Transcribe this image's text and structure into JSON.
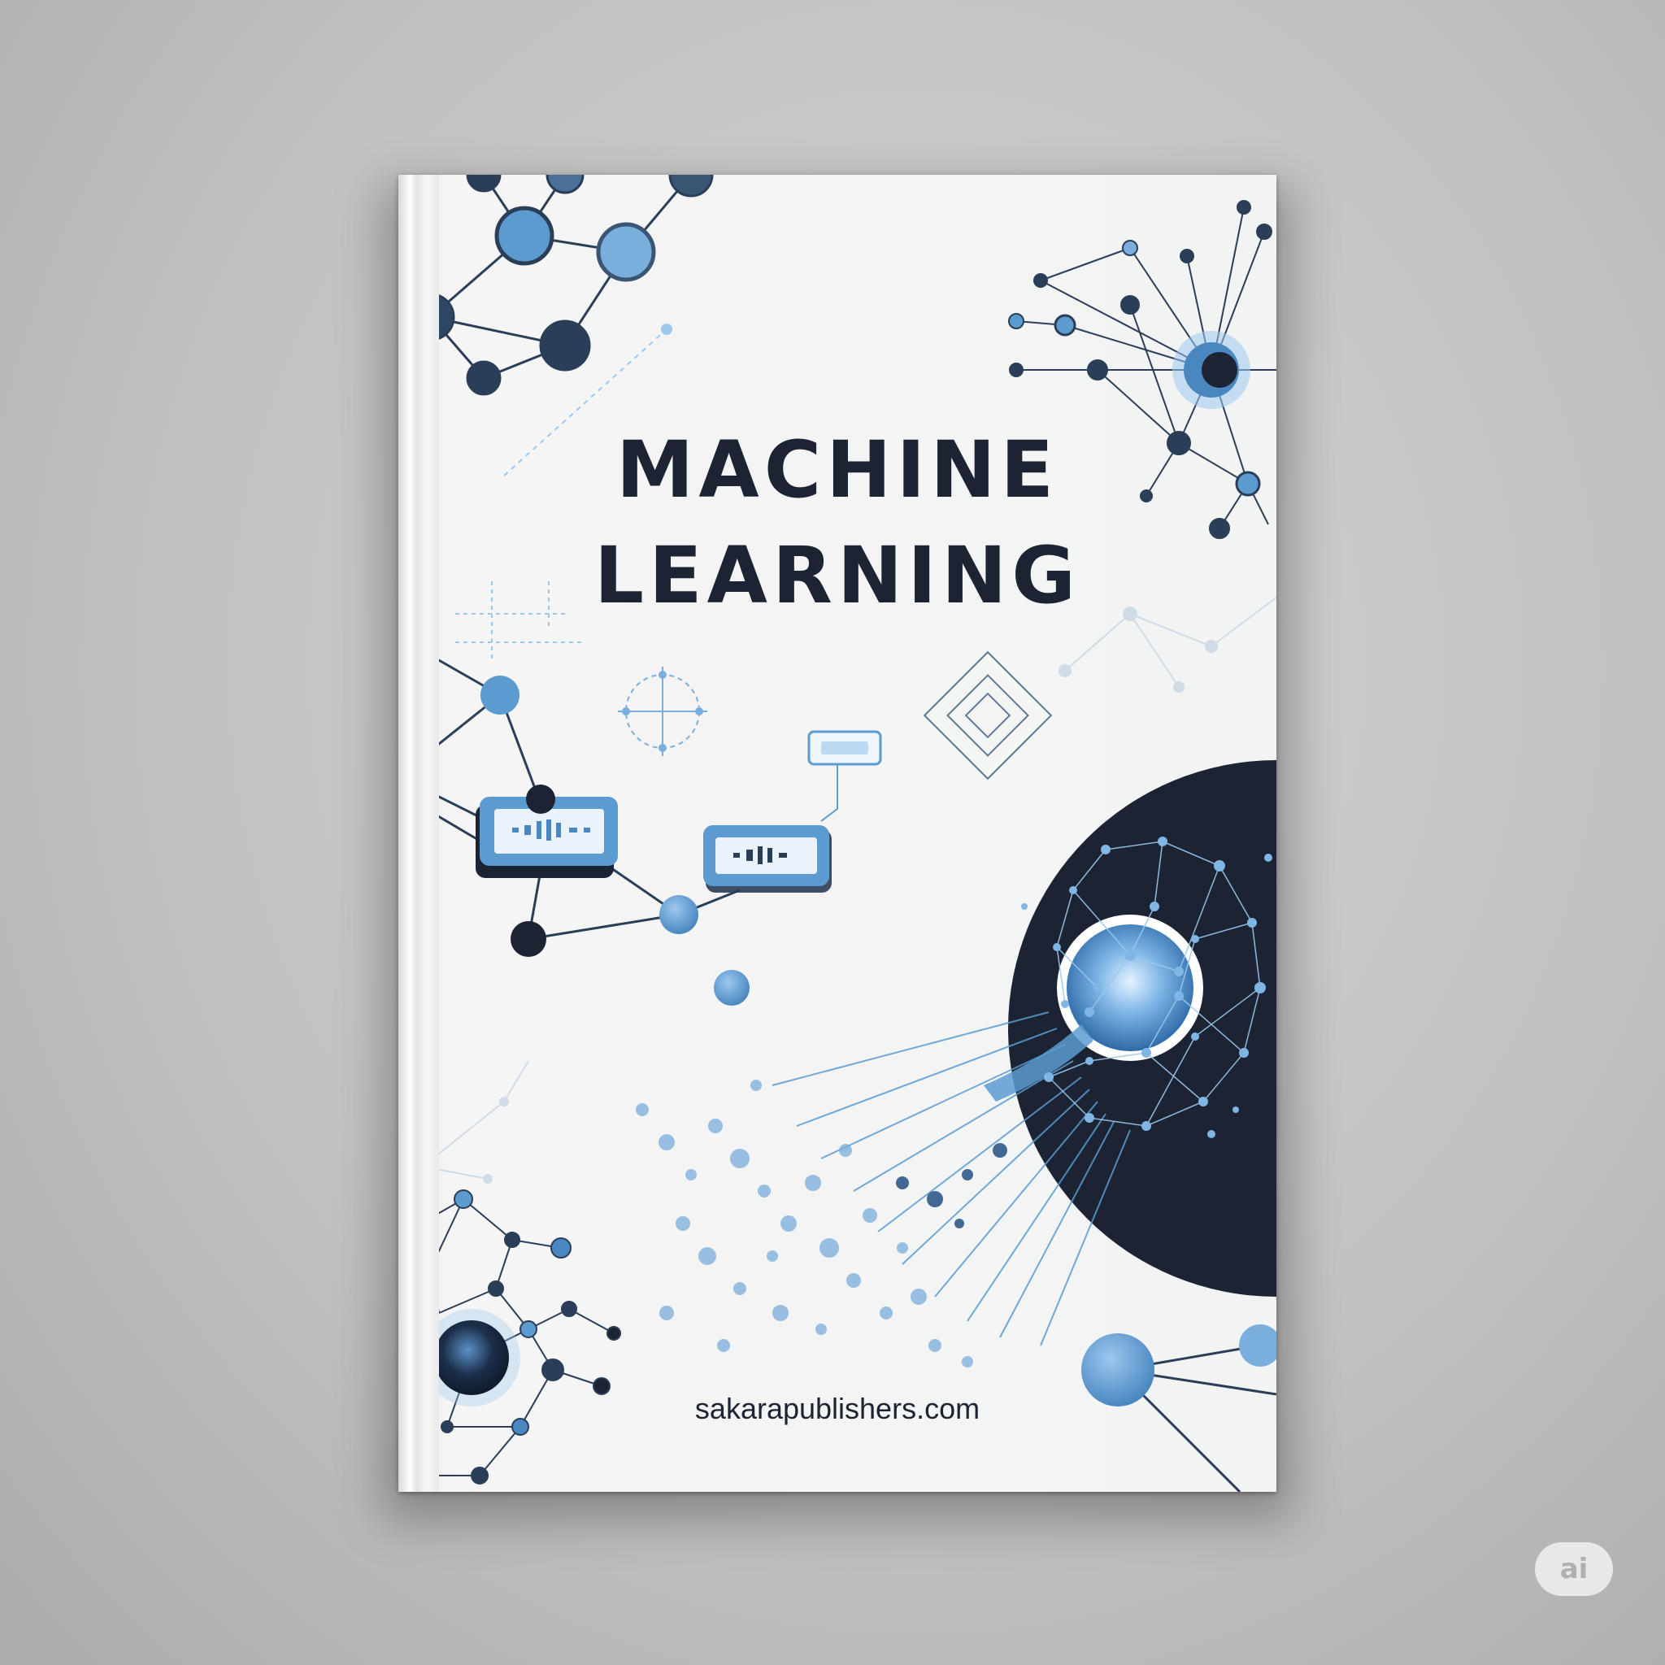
{
  "cover": {
    "title_line1": "MACHINE",
    "title_line2": "LEARNING",
    "publisher_url": "sakarapublishers.com"
  },
  "badge": {
    "label": "ai"
  },
  "colors": {
    "navy": "#1c2433",
    "node_dark": "#3b5575",
    "node_blue": "#5b9bd0",
    "accent_light": "#9cc8ee",
    "paper": "#f2f3f3"
  },
  "icons": [
    "neural-network-icon",
    "data-module-icon",
    "target-crosshair-icon",
    "concentric-diamond-icon",
    "brain-orb-icon"
  ]
}
